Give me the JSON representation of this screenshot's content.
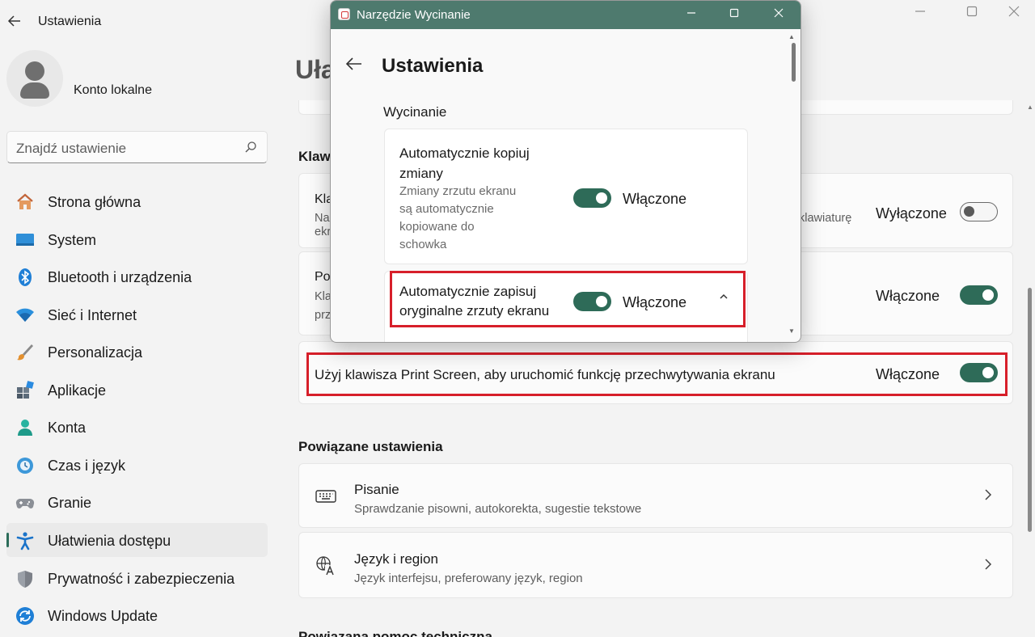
{
  "settings": {
    "title": "Ustawienia",
    "account_name": "Konto lokalne",
    "search_placeholder": "Znajdź ustawienie",
    "page_title_fragment": "Uła",
    "section_keyboard_fragment": "Klaw",
    "nav": [
      {
        "label": "Strona główna",
        "icon": "home-icon"
      },
      {
        "label": "System",
        "icon": "system-icon"
      },
      {
        "label": "Bluetooth i urządzenia",
        "icon": "bluetooth-icon"
      },
      {
        "label": "Sieć i Internet",
        "icon": "wifi-icon"
      },
      {
        "label": "Personalizacja",
        "icon": "brush-icon"
      },
      {
        "label": "Aplikacje",
        "icon": "apps-icon"
      },
      {
        "label": "Konta",
        "icon": "person-icon"
      },
      {
        "label": "Czas i język",
        "icon": "clock-globe-icon"
      },
      {
        "label": "Granie",
        "icon": "gamepad-icon"
      },
      {
        "label": "Ułatwienia dostępu",
        "icon": "accessibility-icon",
        "active": true
      },
      {
        "label": "Prywatność i zabezpieczenia",
        "icon": "shield-icon"
      },
      {
        "label": "Windows Update",
        "icon": "update-icon"
      }
    ],
    "card1": {
      "title_fragment": "Kla",
      "sub1_fragment": "Na",
      "sub2_fragment": "ekr",
      "sub_right_fragment": "klawiaturę",
      "state": "Wyłączone"
    },
    "card2": {
      "title_fragment": "Po",
      "sub1_fragment": "Kla",
      "sub2_fragment": "prz",
      "state": "Włączone"
    },
    "print_screen": {
      "label": "Użyj klawisza Print Screen, aby uruchomić funkcję przechwytywania ekranu",
      "state": "Włączone"
    },
    "related": {
      "heading": "Powiązane ustawienia",
      "items": [
        {
          "title": "Pisanie",
          "subtitle": "Sprawdzanie pisowni, autokorekta, sugestie tekstowe",
          "icon": "keyboard-icon"
        },
        {
          "title": "Język i region",
          "subtitle": "Język interfejsu, preferowany język, region",
          "icon": "language-icon"
        }
      ]
    },
    "bottom_heading_fragment": "Powiązana pomoc techniczna"
  },
  "snip": {
    "window_title": "Narzędzie Wycinanie",
    "heading": "Ustawienia",
    "section": "Wycinanie",
    "copy_card": {
      "title_line1": "Automatycznie kopiuj",
      "title_line2": "zmiany",
      "desc_line1": "Zmiany zrzutu ekranu",
      "desc_line2": "są automatycznie",
      "desc_line3": "kopiowane do",
      "desc_line4": "schowka",
      "state": "Włączone"
    },
    "save_card": {
      "title_line1": "Automatycznie zapisuj",
      "title_line2": "oryginalne zrzuty ekranu",
      "state": "Włączone"
    }
  },
  "colors": {
    "accent": "#2e6b58",
    "highlight": "#d71f2a",
    "snip_titlebar": "#4e7a6e"
  }
}
